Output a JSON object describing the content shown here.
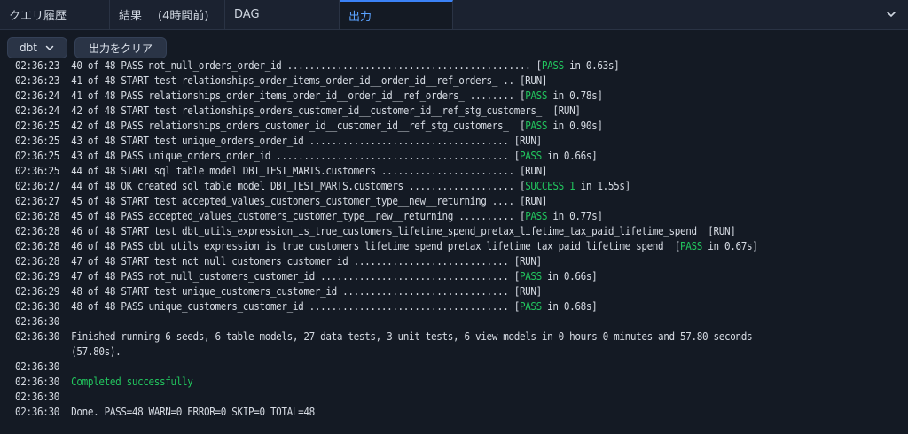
{
  "tabs": [
    {
      "label": "クエリ履歴"
    },
    {
      "label": "結果",
      "sub": "(4時間前)"
    },
    {
      "label": "DAG"
    },
    {
      "label": "出力",
      "active": true
    }
  ],
  "toolbar": {
    "dbt_label": "dbt",
    "clear_label": "出力をクリア"
  },
  "log": [
    {
      "ts": "02:36:23",
      "text": "40 of 48 PASS not_null_orders_order_id ............................................ [",
      "green": "PASS",
      "rest": " in 0.63s]"
    },
    {
      "ts": "02:36:23",
      "text": "41 of 48 START test relationships_order_items_order_id__order_id__ref_orders_ .. [RUN]"
    },
    {
      "ts": "02:36:24",
      "text": "41 of 48 PASS relationships_order_items_order_id__order_id__ref_orders_ ........ [",
      "green": "PASS",
      "rest": " in 0.78s]"
    },
    {
      "ts": "02:36:24",
      "text": "42 of 48 START test relationships_orders_customer_id__customer_id__ref_stg_customers_  [RUN]"
    },
    {
      "ts": "02:36:25",
      "text": "42 of 48 PASS relationships_orders_customer_id__customer_id__ref_stg_customers_  [",
      "green": "PASS",
      "rest": " in 0.90s]"
    },
    {
      "ts": "02:36:25",
      "text": "43 of 48 START test unique_orders_order_id .................................... [RUN]"
    },
    {
      "ts": "02:36:25",
      "text": "43 of 48 PASS unique_orders_order_id .......................................... [",
      "green": "PASS",
      "rest": " in 0.66s]"
    },
    {
      "ts": "02:36:25",
      "text": "44 of 48 START sql table model DBT_TEST_MARTS.customers ........................ [RUN]"
    },
    {
      "ts": "02:36:27",
      "text": "44 of 48 OK created sql table model DBT_TEST_MARTS.customers ................... [",
      "green": "SUCCESS 1",
      "rest": " in 1.55s]"
    },
    {
      "ts": "02:36:27",
      "text": "45 of 48 START test accepted_values_customers_customer_type__new__returning .... [RUN]"
    },
    {
      "ts": "02:36:28",
      "text": "45 of 48 PASS accepted_values_customers_customer_type__new__returning .......... [",
      "green": "PASS",
      "rest": " in 0.77s]"
    },
    {
      "ts": "02:36:28",
      "text": "46 of 48 START test dbt_utils_expression_is_true_customers_lifetime_spend_pretax_lifetime_tax_paid_lifetime_spend  [RUN]"
    },
    {
      "ts": "02:36:28",
      "text": "46 of 48 PASS dbt_utils_expression_is_true_customers_lifetime_spend_pretax_lifetime_tax_paid_lifetime_spend  [",
      "green": "PASS",
      "rest": " in 0.67s]"
    },
    {
      "ts": "02:36:28",
      "text": "47 of 48 START test not_null_customers_customer_id ............................ [RUN]"
    },
    {
      "ts": "02:36:29",
      "text": "47 of 48 PASS not_null_customers_customer_id .................................. [",
      "green": "PASS",
      "rest": " in 0.66s]"
    },
    {
      "ts": "02:36:29",
      "text": "48 of 48 START test unique_customers_customer_id .............................. [RUN]"
    },
    {
      "ts": "02:36:30",
      "text": "48 of 48 PASS unique_customers_customer_id .................................... [",
      "green": "PASS",
      "rest": " in 0.68s]"
    },
    {
      "ts": "02:36:30",
      "text": ""
    },
    {
      "ts": "02:36:30",
      "text": "Finished running 6 seeds, 6 table models, 27 data tests, 3 unit tests, 6 view models in 0 hours 0 minutes and 57.80 seconds"
    },
    {
      "ts": "",
      "text": "(57.80s)."
    },
    {
      "ts": "02:36:30",
      "text": ""
    },
    {
      "ts": "02:36:30",
      "text": "",
      "green": "Completed successfully"
    },
    {
      "ts": "02:36:30",
      "text": ""
    },
    {
      "ts": "02:36:30",
      "text": "Done. PASS=48 WARN=0 ERROR=0 SKIP=0 TOTAL=48"
    }
  ]
}
